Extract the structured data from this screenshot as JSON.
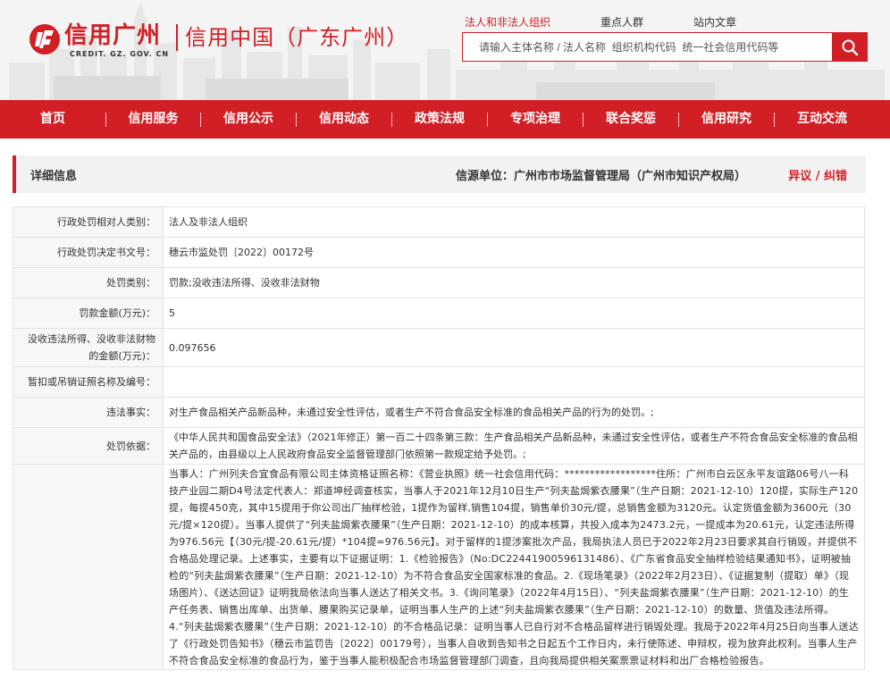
{
  "logo": {
    "cn": "信用广州",
    "en": "CREDIT. GZ. GOV. CN",
    "right": "信用中国（广东广州）"
  },
  "search": {
    "tabs": [
      "法人和非法人组织",
      "重点人群",
      "站内文章"
    ],
    "placeholder": "请输入主体名称 / 法人名称  组织机构代码  统一社会信用代码等"
  },
  "nav": [
    "首页",
    "信用服务",
    "信用公示",
    "信用动态",
    "政策法规",
    "专项治理",
    "联合奖惩",
    "信用研究",
    "互动交流"
  ],
  "detail": {
    "title": "详细信息",
    "source": "信源单位：广州市市场监督管理局（广州市知识产权局）",
    "objection": "异议 / 纠错"
  },
  "rows": [
    {
      "label": "行政处罚相对人类别：",
      "value": "法人及非法人组织"
    },
    {
      "label": "行政处罚决定书文号：",
      "value": "穗云市监处罚〔2022〕00172号"
    },
    {
      "label": "处罚类别：",
      "value": "罚款;没收违法所得、没收非法财物"
    },
    {
      "label": "罚款金额(万元)：",
      "value": "5"
    },
    {
      "label": "没收违法所得、没收非法财物的金额(万元)：",
      "value": "0.097656"
    },
    {
      "label": "暂扣或吊销证照名称及编号：",
      "value": ""
    },
    {
      "label": "违法事实：",
      "value": "对生产食品相关产品新品种，未通过安全性评估，或者生产不符合食品安全标准的食品相关产品的行为的处罚。;"
    },
    {
      "label": "处罚依据：",
      "value": "《中华人民共和国食品安全法》（2021年修正）第一百二十四条第三款：生产食品相关产品新品种，未通过安全性评估，或者生产不符合食品安全标准的食品相关产品的，由县级以上人民政府食品安全监督管理部门依照第一款规定给予处罚。;"
    },
    {
      "label": "",
      "value": "当事人：广州列夫合宜食品有限公司主体资格证照名称：《营业执照》统一社会信用代码：******************住所：广州市白云区永平友谊路06号八一科技产业园二期D4号法定代表人：郑道坤经调查核实，当事人于2021年12月10日生产“列夫盐焗紫衣腰果”（生产日期：2021-12-10）120提，实际生产120提，每提450克，其中15提用于你公司出厂抽样检验，1提作为留样,销售104提，销售单价30元/提，总销售金额为3120元。认定货值金额为3600元（30元/提×120提）。当事人提供了“列夫盐焗紫衣腰果”（生产日期：2021-12-10）的成本核算，共投入成本为2473.2元，一提成本为20.61元，认定违法所得为976.56元【（30元/提-20.61元/提）*104提=976.56元】。对于留样的1提涉案批次产品，我局执法人员已于2022年2月23日要求其自行销毁，并提供不合格品处理记录。上述事实，主要有以下证据证明：1.《检验报告》（No:DC22441900596131486）、《广东省食品安全抽样检验结果通知书》，证明被抽检的“列夫盐焗紫衣腰果”（生产日期：2021-12-10）为不符合食品安全国家标准的食品。2.《现场笔录》（2022年2月23日）、《证据复制（提取）单》（现场图片）、《送达回证》证明我局依法向当事人送达了相关文书。3.《询问笔录》（2022年4月15日）、“列夫盐焗紫衣腰果”（生产日期：2021-12-10）的生产任务表、销售出库单、出货单、腰果购买记录单，证明当事人生产的上述“列夫盐焗紫衣腰果”（生产日期：2021-12-10）的数量、货值及违法所得。4.“列夫盐焗紫衣腰果”（生产日期：2021-12-10）的不合格品记录：证明当事人已自行对不合格品留样进行销毁处理。我局于2022年4月25日向当事人送达了《行政处罚告知书》（穗云市监罚告〔2022〕00179号），当事人自收到告知书之日起五个工作日内，未行使陈述、申辩权，视为放弃此权利。当事人生产不符合食品安全标准的食品行为，鉴于当事人能积极配合市场监督管理部门调查，且向我局提供相关案票票证材料和出厂合格检验报告。"
    }
  ],
  "colors": {
    "brand": "#d21f26",
    "label_bg": "#f7f7f7"
  }
}
